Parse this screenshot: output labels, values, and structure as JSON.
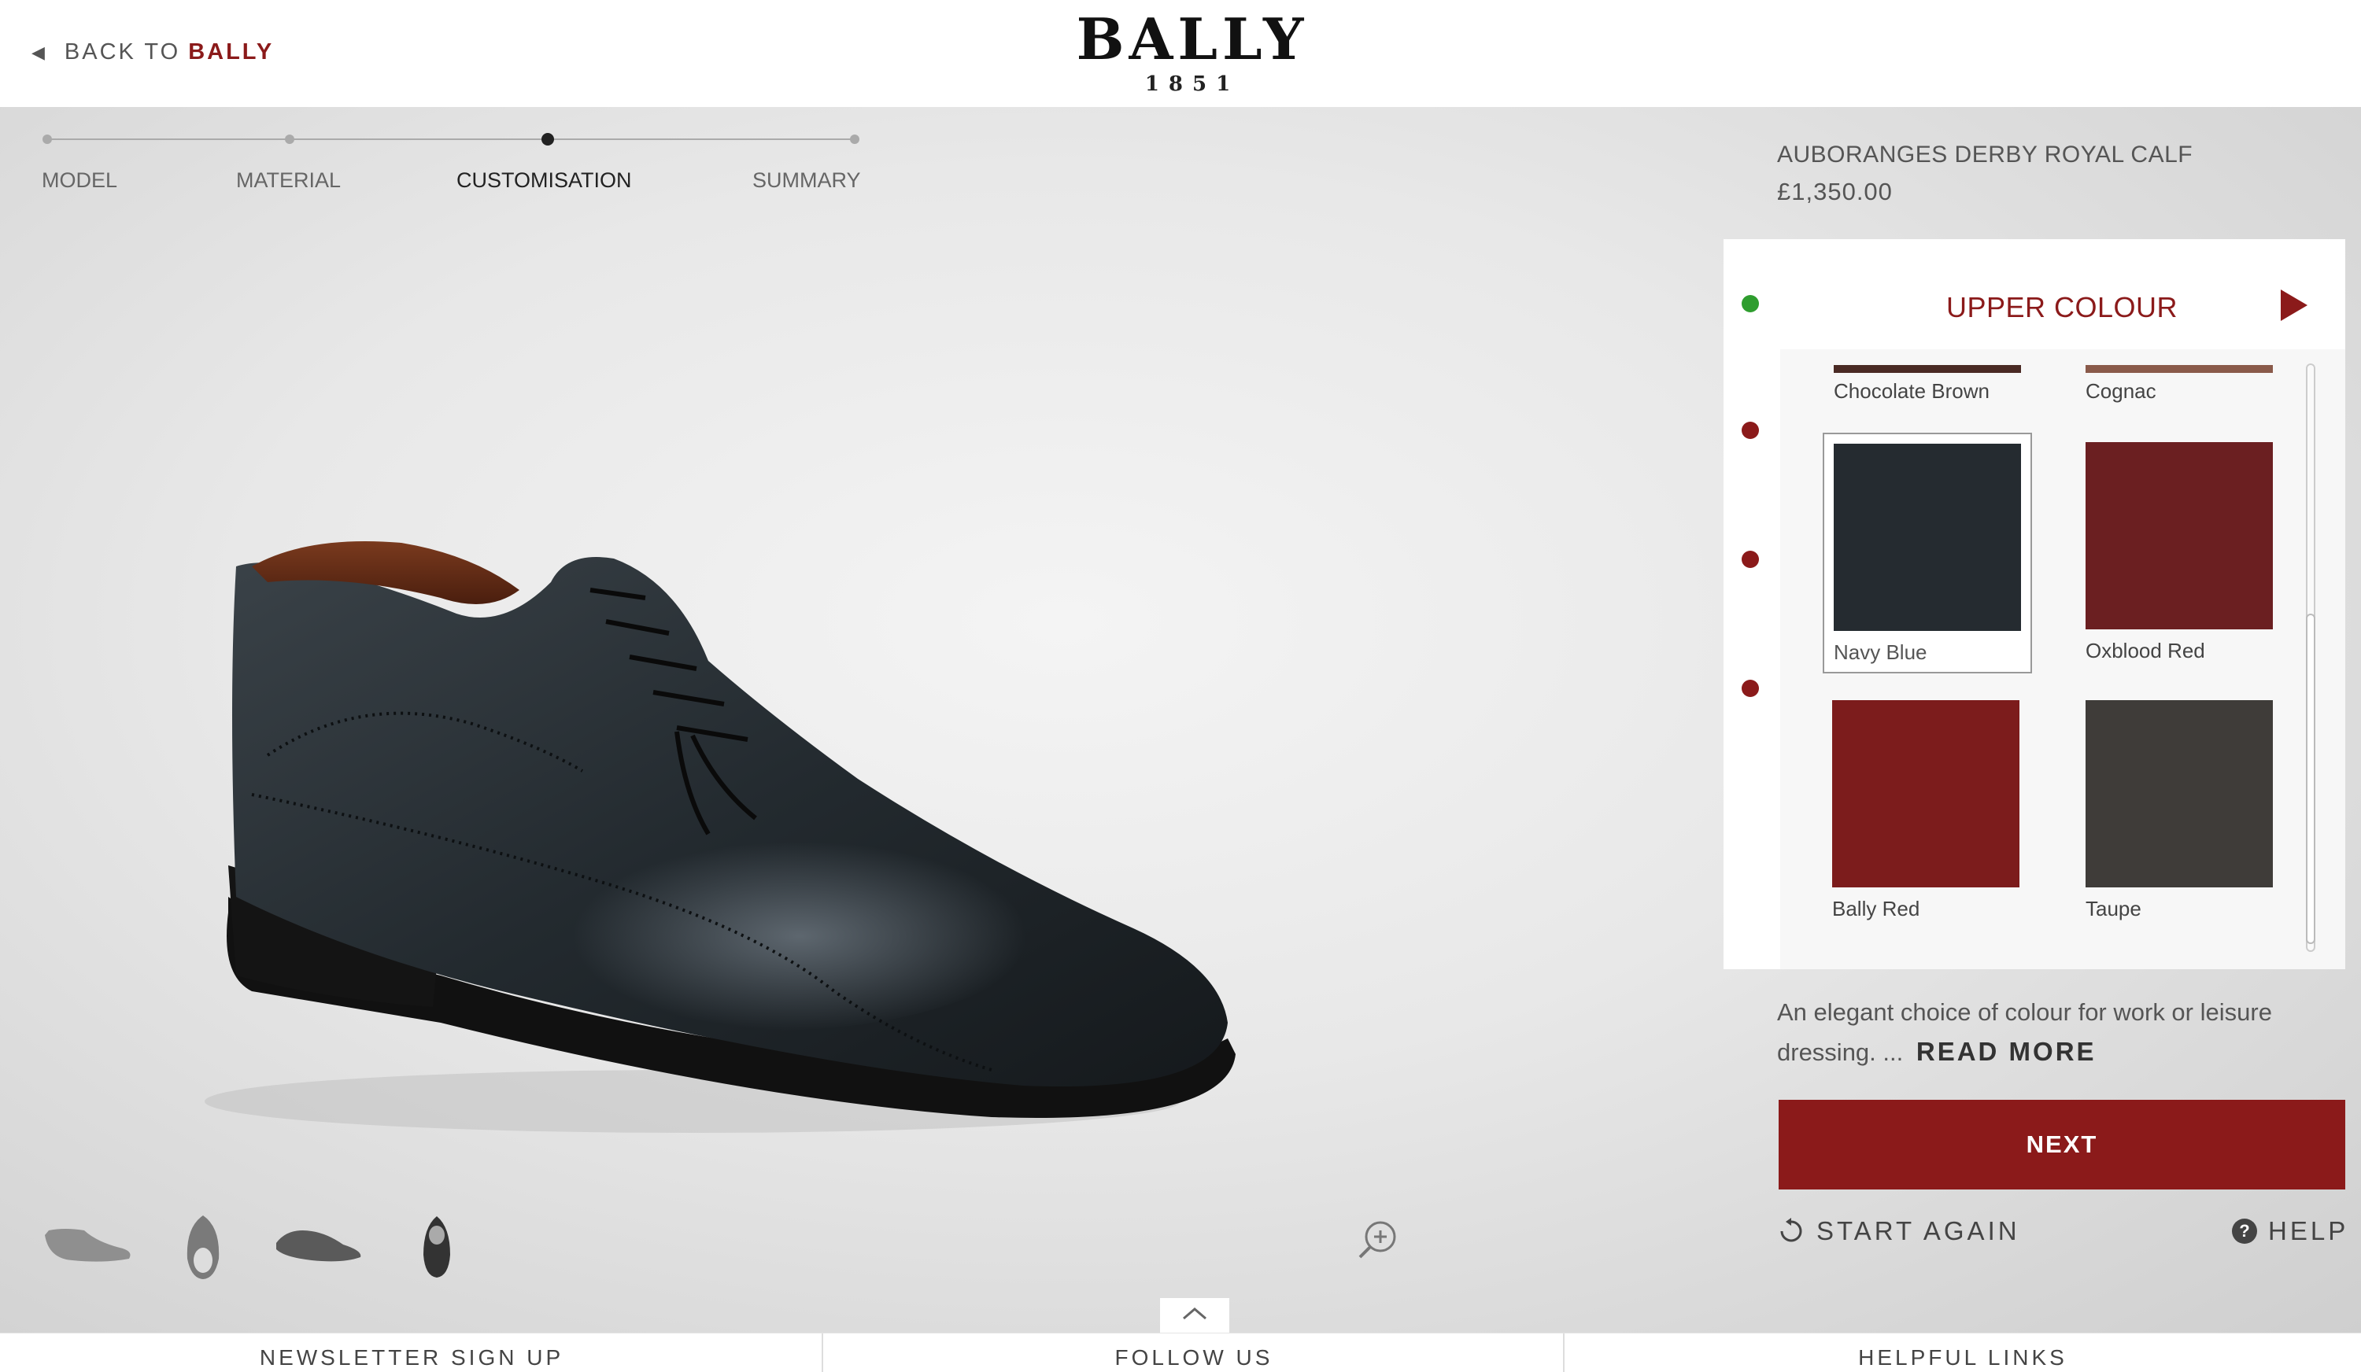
{
  "header": {
    "back_prefix": "BACK TO",
    "back_brand": "BALLY",
    "logo_word": "BALLY",
    "logo_year": "1851"
  },
  "steps": [
    {
      "label": "MODEL",
      "active": false
    },
    {
      "label": "MATERIAL",
      "active": false
    },
    {
      "label": "CUSTOMISATION",
      "active": true
    },
    {
      "label": "SUMMARY",
      "active": false
    }
  ],
  "product": {
    "name": "AUBORANGES DERBY ROYAL CALF",
    "price": "£1,350.00"
  },
  "panel": {
    "title": "UPPER COLOUR",
    "swatches": [
      {
        "label": "Chocolate Brown",
        "color": "#4a2a24",
        "partial": true
      },
      {
        "label": "Cognac",
        "color": "#8a5a4a",
        "partial": true
      },
      {
        "label": "Navy Blue",
        "color": "#252b30",
        "selected": true
      },
      {
        "label": "Oxblood Red",
        "color": "#6b1f21"
      },
      {
        "label": "Bally Red",
        "color": "#7c1c1c"
      },
      {
        "label": "Taupe",
        "color": "#3f3c39"
      }
    ]
  },
  "description": {
    "text": "An elegant choice of colour for work or leisure dressing. ...",
    "read_more": "READ MORE"
  },
  "actions": {
    "next": "NEXT",
    "start_again": "START AGAIN",
    "help": "HELP"
  },
  "footer": {
    "newsletter": "NEWSLETTER SIGN UP",
    "follow": "FOLLOW US",
    "links": "HELPFUL LINKS"
  },
  "colors": {
    "accent": "#8b1a1a",
    "status_complete": "#2e9d2e"
  },
  "icons": [
    "back-arrow-icon",
    "zoom-in-icon",
    "next-arrow-icon",
    "restart-icon",
    "help-icon",
    "chevron-up-icon"
  ]
}
